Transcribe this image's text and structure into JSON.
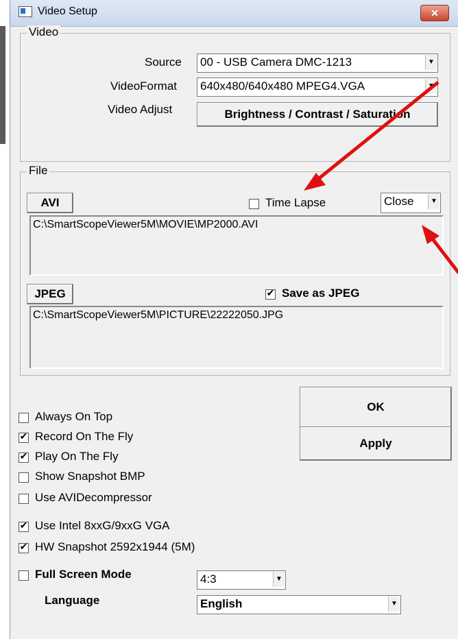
{
  "window": {
    "title": "Video Setup",
    "close_symbol": "✕"
  },
  "video": {
    "group_label": "Video",
    "source_label": "Source",
    "source_value": "00 - USB Camera DMC-1213",
    "format_label": "VideoFormat",
    "format_value": "640x480/640x480 MPEG4.VGA",
    "adjust_label": "Video Adjust",
    "adjust_button": "Brightness / Contrast / Saturation"
  },
  "file": {
    "group_label": "File",
    "avi_button": "AVI",
    "time_lapse_label": "Time Lapse",
    "time_lapse_checked": false,
    "close_value": "Close",
    "avi_path": "C:\\SmartScopeViewer5M\\MOVIE\\MP2000.AVI",
    "jpeg_button": "JPEG",
    "save_jpeg_label": "Save as JPEG",
    "save_jpeg_checked": true,
    "jpeg_path": "C:\\SmartScopeViewer5M\\PICTURE\\22222050.JPG"
  },
  "buttons": {
    "ok": "OK",
    "apply": "Apply"
  },
  "options": {
    "always_on_top": {
      "label": "Always On Top",
      "checked": false
    },
    "record_on_fly": {
      "label": "Record On The Fly",
      "checked": true
    },
    "play_on_fly": {
      "label": "Play On The Fly",
      "checked": true
    },
    "show_snapshot": {
      "label": "Show Snapshot BMP",
      "checked": false
    },
    "use_avi_decompressor": {
      "label": "Use AVIDecompressor",
      "checked": false
    },
    "use_intel": {
      "label": "Use Intel 8xxG/9xxG VGA",
      "checked": true
    },
    "hw_snapshot": {
      "label": "HW Snapshot 2592x1944 (5M)",
      "checked": true
    },
    "full_screen": {
      "label": "Full Screen Mode",
      "checked": false
    }
  },
  "aspect_value": "4:3",
  "language_label": "Language",
  "language_value": "English",
  "dropdown_arrow": "▼",
  "check_mark": "✔",
  "colors": {
    "annotation_arrow": "#e01010",
    "titlebar": "#c8d8ec",
    "dialog_bg": "#f0f0f0"
  }
}
